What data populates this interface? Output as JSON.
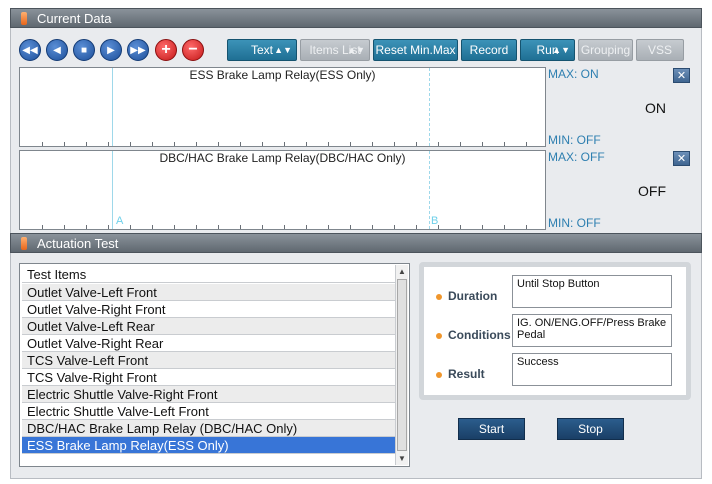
{
  "current_data": {
    "title": "Current Data",
    "toolbar": {
      "text_label": "Text",
      "items_list_label": "Items List",
      "reset_label": "Reset Min.Max",
      "record_label": "Record",
      "run_label": "Run",
      "grouping_label": "Grouping",
      "vss_label": "VSS"
    },
    "graphs": [
      {
        "title": "ESS Brake Lamp Relay(ESS Only)",
        "max": "MAX: ON",
        "min": "MIN: OFF",
        "state": "ON"
      },
      {
        "title": "DBC/HAC Brake Lamp Relay(DBC/HAC Only)",
        "max": "MAX: OFF",
        "min": "MIN: OFF",
        "state": "OFF"
      }
    ],
    "marker_a": "A",
    "marker_b": "B"
  },
  "actuation_test": {
    "title": "Actuation Test",
    "list_header": "Test Items",
    "items": [
      "Outlet Valve-Left Front",
      "Outlet Valve-Right Front",
      "Outlet Valve-Left Rear",
      "Outlet Valve-Right Rear",
      "TCS Valve-Left Front",
      "TCS Valve-Right Front",
      "Electric Shuttle Valve-Right Front",
      "Electric Shuttle Valve-Left Front",
      "DBC/HAC Brake Lamp Relay (DBC/HAC Only)",
      "ESS Brake Lamp Relay(ESS Only)"
    ],
    "selected_index": 9,
    "duration_label": "Duration",
    "duration_value": "Until Stop Button",
    "conditions_label": "Conditions",
    "conditions_value": "IG. ON/ENG.OFF/Press Brake Pedal",
    "result_label": "Result",
    "result_value": "Success",
    "start_label": "Start",
    "stop_label": "Stop"
  },
  "colors": {
    "header": "#6d757d",
    "button": "#2a7fa6",
    "selected": "#3875d7"
  }
}
